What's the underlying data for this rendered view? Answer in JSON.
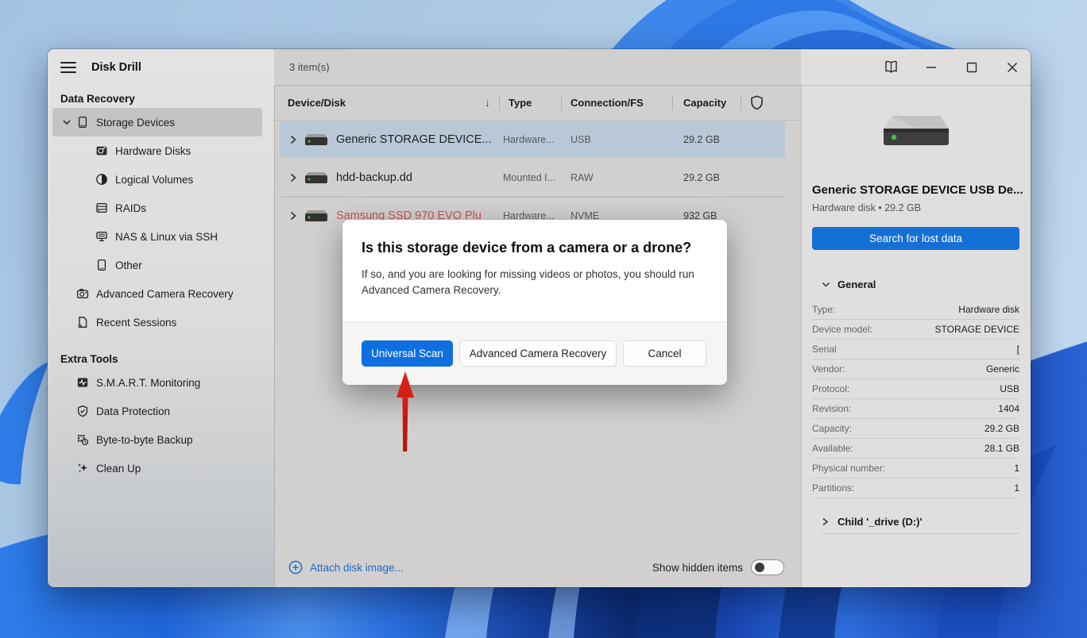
{
  "app": {
    "title": "Disk Drill"
  },
  "titlebar": {
    "count": "3 item(s)"
  },
  "sidebar": {
    "sections": [
      {
        "header": "Data Recovery",
        "items": [
          {
            "label": "Storage Devices"
          },
          {
            "label": "Hardware Disks"
          },
          {
            "label": "Logical Volumes"
          },
          {
            "label": "RAIDs"
          },
          {
            "label": "NAS & Linux via SSH"
          },
          {
            "label": "Other"
          },
          {
            "label": "Advanced Camera Recovery"
          },
          {
            "label": "Recent Sessions"
          }
        ]
      },
      {
        "header": "Extra Tools",
        "items": [
          {
            "label": "S.M.A.R.T. Monitoring"
          },
          {
            "label": "Data Protection"
          },
          {
            "label": "Byte-to-byte Backup"
          },
          {
            "label": "Clean Up"
          }
        ]
      }
    ]
  },
  "table": {
    "columns": [
      "Device/Disk",
      "Type",
      "Connection/FS",
      "Capacity"
    ],
    "sort_icon": "↓",
    "rows": [
      {
        "name": "Generic STORAGE DEVICE...",
        "type": "Hardware...",
        "fs": "USB",
        "capacity": "29.2 GB"
      },
      {
        "name": "hdd-backup.dd",
        "type": "Mounted I...",
        "fs": "RAW",
        "capacity": "29.2 GB"
      },
      {
        "name": "Samsung SSD 970 EVO Plu",
        "type": "Hardware...",
        "fs": "NVME",
        "capacity": "932 GB"
      }
    ]
  },
  "main_footer": {
    "attach_label": "Attach disk image...",
    "show_hidden_label": "Show hidden items"
  },
  "dialog": {
    "title": "Is this storage device from a camera or a drone?",
    "body": "If so, and you are looking for missing videos or photos, you should run Advanced Camera Recovery.",
    "primary_label": "Universal Scan",
    "secondary_label": "Advanced Camera Recovery",
    "cancel_label": "Cancel"
  },
  "details": {
    "device_title": "Generic STORAGE DEVICE USB De...",
    "device_subtitle": "Hardware disk • 29.2 GB",
    "search_label": "Search for lost data",
    "general_header": "General",
    "rows": [
      {
        "label": "Type:",
        "value": "Hardware disk"
      },
      {
        "label": "Device model:",
        "value": "STORAGE DEVICE"
      },
      {
        "label": "Serial",
        "value": "["
      },
      {
        "label": "Vendor:",
        "value": "Generic"
      },
      {
        "label": "Protocol:",
        "value": "USB"
      },
      {
        "label": "Revision:",
        "value": "1404"
      },
      {
        "label": "Capacity:",
        "value": "29.2 GB"
      },
      {
        "label": "Available:",
        "value": "28.1 GB"
      },
      {
        "label": "Physical number:",
        "value": "1"
      },
      {
        "label": "Partitions:",
        "value": "1"
      }
    ],
    "child_label": "Child '_drive (D:)'"
  },
  "colors": {
    "accent_blue": "#0f6fe0",
    "selected_row": "#b9c8d7",
    "danger_text": "#c1554f",
    "link_blue": "#1b6cc2",
    "arrow_red": "#d61f1f"
  }
}
